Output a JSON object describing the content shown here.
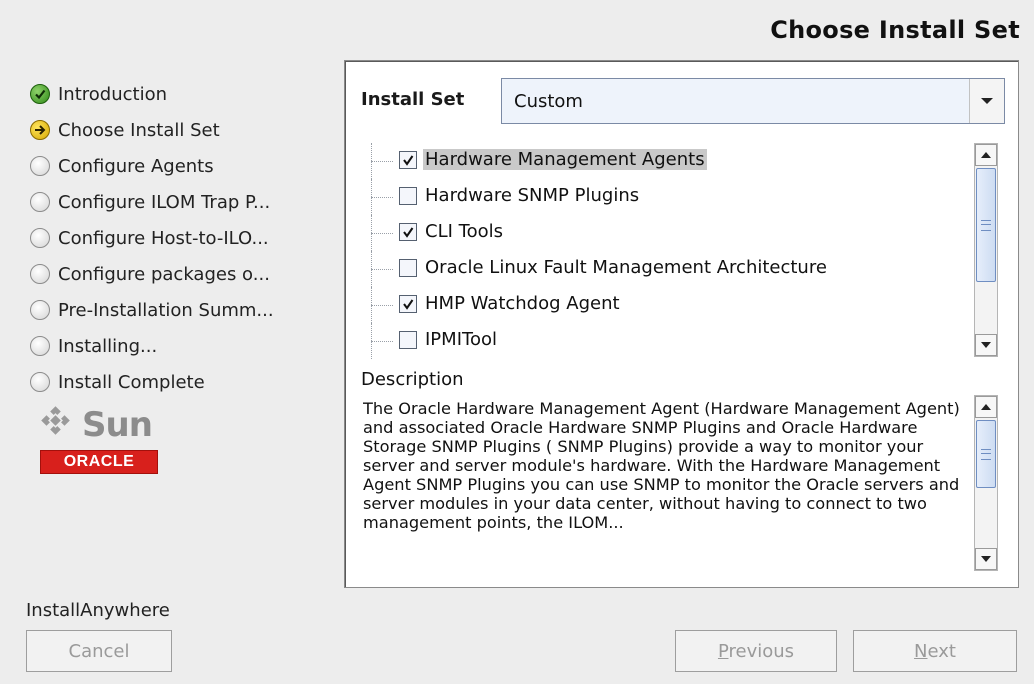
{
  "title": "Choose Install Set",
  "steps": [
    {
      "label": "Introduction",
      "state": "done"
    },
    {
      "label": "Choose Install Set",
      "state": "current"
    },
    {
      "label": "Configure Agents",
      "state": "pending"
    },
    {
      "label": "Configure ILOM Trap P...",
      "state": "pending"
    },
    {
      "label": "Configure Host-to-ILO...",
      "state": "pending"
    },
    {
      "label": "Configure packages o...",
      "state": "pending"
    },
    {
      "label": "Pre-Installation Summ...",
      "state": "pending"
    },
    {
      "label": "Installing...",
      "state": "pending"
    },
    {
      "label": "Install Complete",
      "state": "pending"
    }
  ],
  "logos": {
    "sun": "Sun",
    "oracle": "ORACLE"
  },
  "install_set": {
    "label": "Install Set",
    "value": "Custom"
  },
  "features": [
    {
      "label": "Hardware Management Agents",
      "checked": true,
      "selected": true
    },
    {
      "label": "Hardware SNMP Plugins",
      "checked": false,
      "selected": false
    },
    {
      "label": "CLI Tools",
      "checked": true,
      "selected": false
    },
    {
      "label": "Oracle Linux Fault Management Architecture",
      "checked": false,
      "selected": false
    },
    {
      "label": "HMP Watchdog Agent",
      "checked": true,
      "selected": false
    },
    {
      "label": "IPMITool",
      "checked": false,
      "selected": false
    }
  ],
  "description": {
    "label": "Description",
    "text": "The Oracle Hardware Management Agent (Hardware Management Agent) and associated Oracle Hardware SNMP Plugins and Oracle Hardware Storage SNMP Plugins ( SNMP Plugins) provide a way to monitor your server and server module's hardware. With the Hardware Management Agent SNMP Plugins you can use SNMP to monitor the Oracle servers and server modules in your data center, without having to connect to two management points, the ILOM..."
  },
  "footer": {
    "brand": "InstallAnywhere"
  },
  "buttons": {
    "cancel": "Cancel",
    "previous": "Previous",
    "next": "Next"
  },
  "colors": {
    "oracle_red": "#d8201c",
    "selection": "#c9c9c9",
    "scroll_thumb": "#cddcf2"
  }
}
